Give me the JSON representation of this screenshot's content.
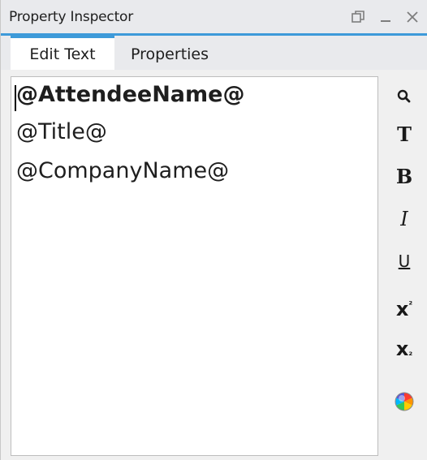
{
  "window": {
    "title": "Property Inspector",
    "buttons": {
      "restore": "🗗",
      "minimize": "_",
      "close": "✕"
    }
  },
  "tabs": [
    {
      "label": "Edit Text",
      "active": true
    },
    {
      "label": "Properties",
      "active": false
    }
  ],
  "editor": {
    "lines": [
      {
        "text": "@AttendeeName@",
        "bold": true
      },
      {
        "text": "@Title@",
        "bold": false
      },
      {
        "text": "@CompanyName@",
        "bold": false
      }
    ]
  },
  "toolbar": {
    "search": "🔍",
    "text": "T",
    "bold": "B",
    "italic": "I",
    "underline": "U",
    "superscript_base": "x",
    "superscript_mark": "²",
    "subscript_base": "x",
    "subscript_mark": "₂"
  },
  "colors": {
    "accent": "#3d9ad9",
    "panel_bg": "#f0f0f0",
    "titlebar_bg": "#e9eaed",
    "editor_bg": "#ffffff"
  }
}
